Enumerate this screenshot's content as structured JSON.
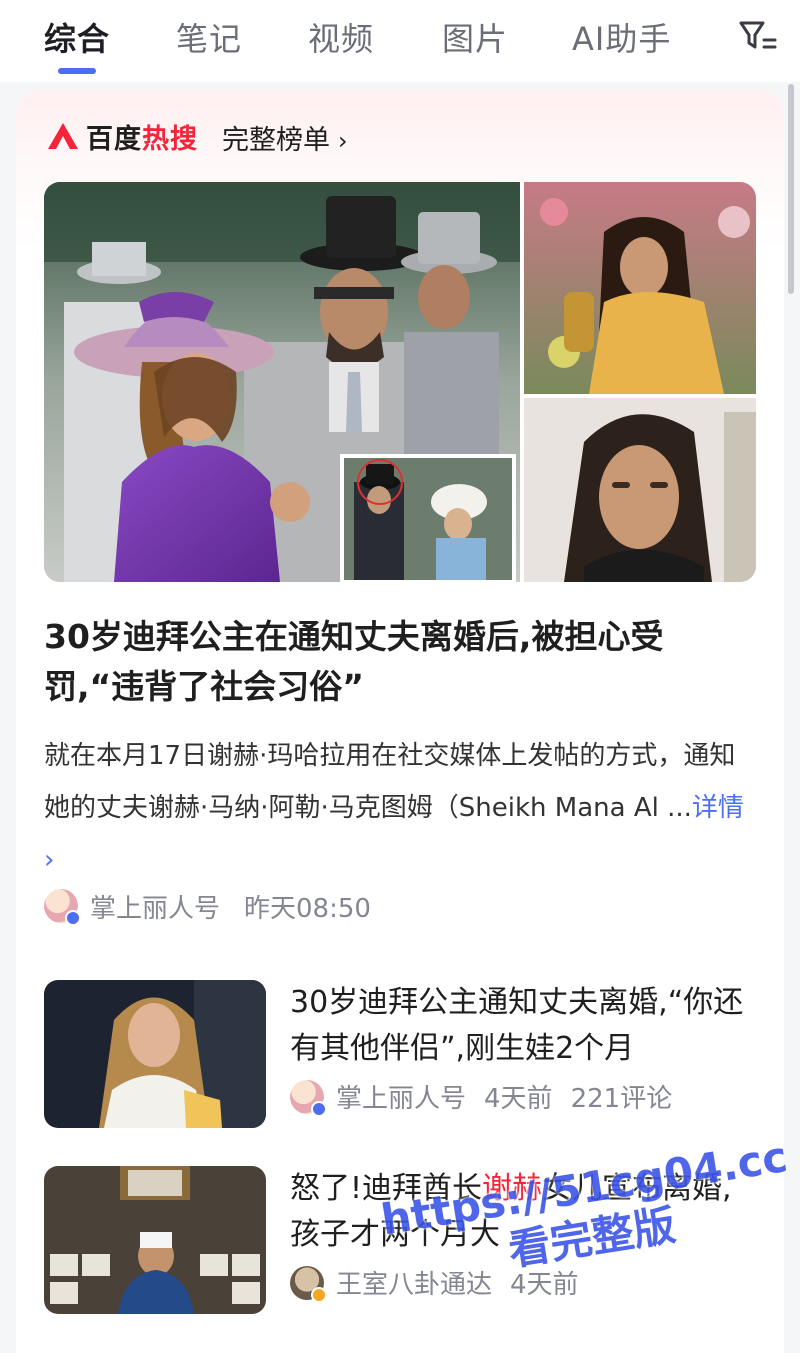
{
  "tabs": [
    {
      "label": "综合",
      "active": true
    },
    {
      "label": "笔记",
      "active": false
    },
    {
      "label": "视频",
      "active": false
    },
    {
      "label": "图片",
      "active": false
    },
    {
      "label": "AI助手",
      "active": false
    }
  ],
  "filter_icon": "filter-icon",
  "hot": {
    "logo_plain": "百度",
    "logo_accent": "热搜",
    "full_list_label": "完整榜单",
    "full_list_chevron": "›",
    "accent_color": "#f2253a"
  },
  "main_article": {
    "headline": "30岁迪拜公主在通知丈夫离婚后,被担心受罚,“违背了社会习俗”",
    "summary": "就在本月17日谢赫·玛哈拉用在社交媒体上发帖的方式，通知她的丈夫谢赫·马纳·阿勒·马克图姆（Sheikh Mana Al ...",
    "more_label": "详情 ›",
    "source": "掌上丽人号",
    "time": "昨天08:50"
  },
  "related": [
    {
      "title": "30岁迪拜公主通知丈夫离婚,“你还有其他伴侣”,刚生娃2个月",
      "source": "掌上丽人号",
      "time": "4天前",
      "comments": "221评论"
    },
    {
      "title_before": "怒了!迪拜酋长",
      "title_highlight": "谢赫",
      "title_after": "女儿宣布离婚,孩子才两个月大",
      "source": "王室八卦通达",
      "time": "4天前"
    }
  ],
  "watermark": {
    "line1": "https://51cg04.cc",
    "line2": "看完整版"
  },
  "colors": {
    "link": "#4e6ef2",
    "meta_text": "#848691"
  }
}
